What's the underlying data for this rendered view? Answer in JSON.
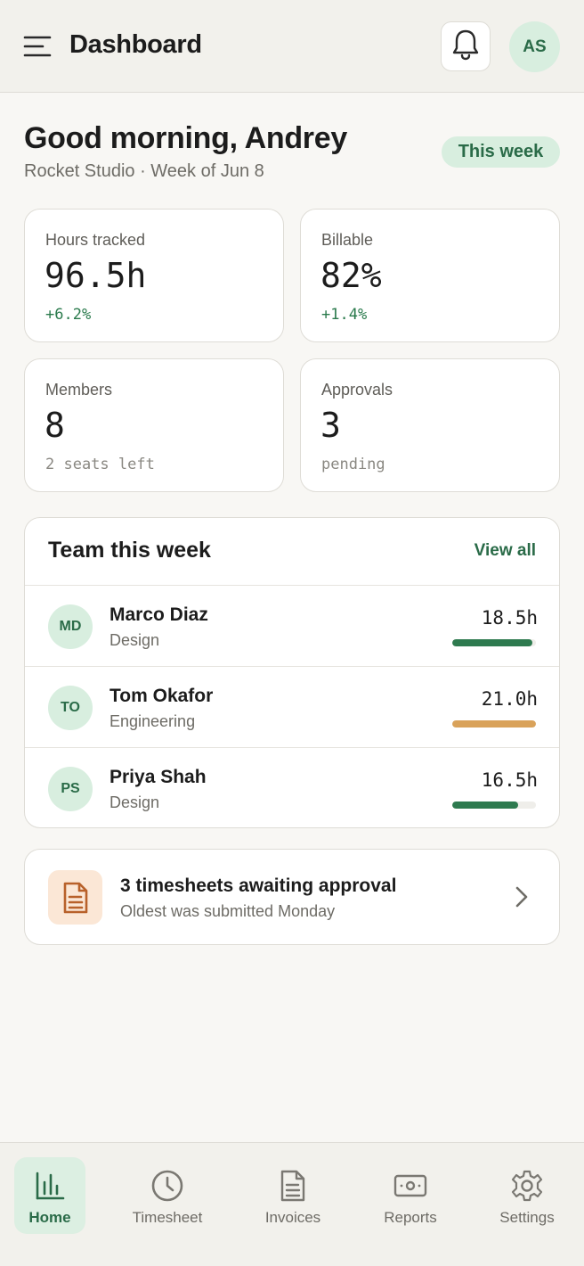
{
  "header": {
    "title": "Dashboard",
    "avatar_initials": "AS"
  },
  "greeting": {
    "title": "Good morning, Andrey",
    "subtitle": "Rocket Studio · Week of Jun 8",
    "period_pill": "This week"
  },
  "stats": [
    {
      "label": "Hours tracked",
      "value": "96.5h",
      "detail": "+6.2%"
    },
    {
      "label": "Billable",
      "value": "82%",
      "detail": "+1.4%"
    },
    {
      "label": "Members",
      "value": "8",
      "detail": "2 seats left"
    },
    {
      "label": "Approvals",
      "value": "3",
      "detail": "pending"
    }
  ],
  "team": {
    "title": "Team this week",
    "view_all": "View all",
    "members": [
      {
        "initials": "MD",
        "name": "Marco Diaz",
        "dept": "Design",
        "hours": "18.5h",
        "progress": 0.96,
        "color": "#2e7a4f"
      },
      {
        "initials": "TO",
        "name": "Tom Okafor",
        "dept": "Engineering",
        "hours": "21.0h",
        "progress": 1.0,
        "color": "#d9a25a"
      },
      {
        "initials": "PS",
        "name": "Priya Shah",
        "dept": "Design",
        "hours": "16.5h",
        "progress": 0.79,
        "color": "#2e7a4f"
      }
    ]
  },
  "approval_notice": {
    "title": "3 timesheets awaiting approval",
    "subtitle": "Oldest was submitted Monday",
    "icon": "document-icon"
  },
  "nav": {
    "items": [
      {
        "label": "Home",
        "icon": "bar-chart-icon",
        "active": true
      },
      {
        "label": "Timesheet",
        "icon": "clock-icon",
        "active": false
      },
      {
        "label": "Invoices",
        "icon": "document-icon",
        "active": false
      },
      {
        "label": "Reports",
        "icon": "banknote-icon",
        "active": false
      },
      {
        "label": "Settings",
        "icon": "gear-icon",
        "active": false
      }
    ]
  },
  "colors": {
    "accent": "#2a6b48",
    "accent_soft": "#d8eedf",
    "warning": "#d9a25a",
    "background": "#f8f7f4"
  }
}
